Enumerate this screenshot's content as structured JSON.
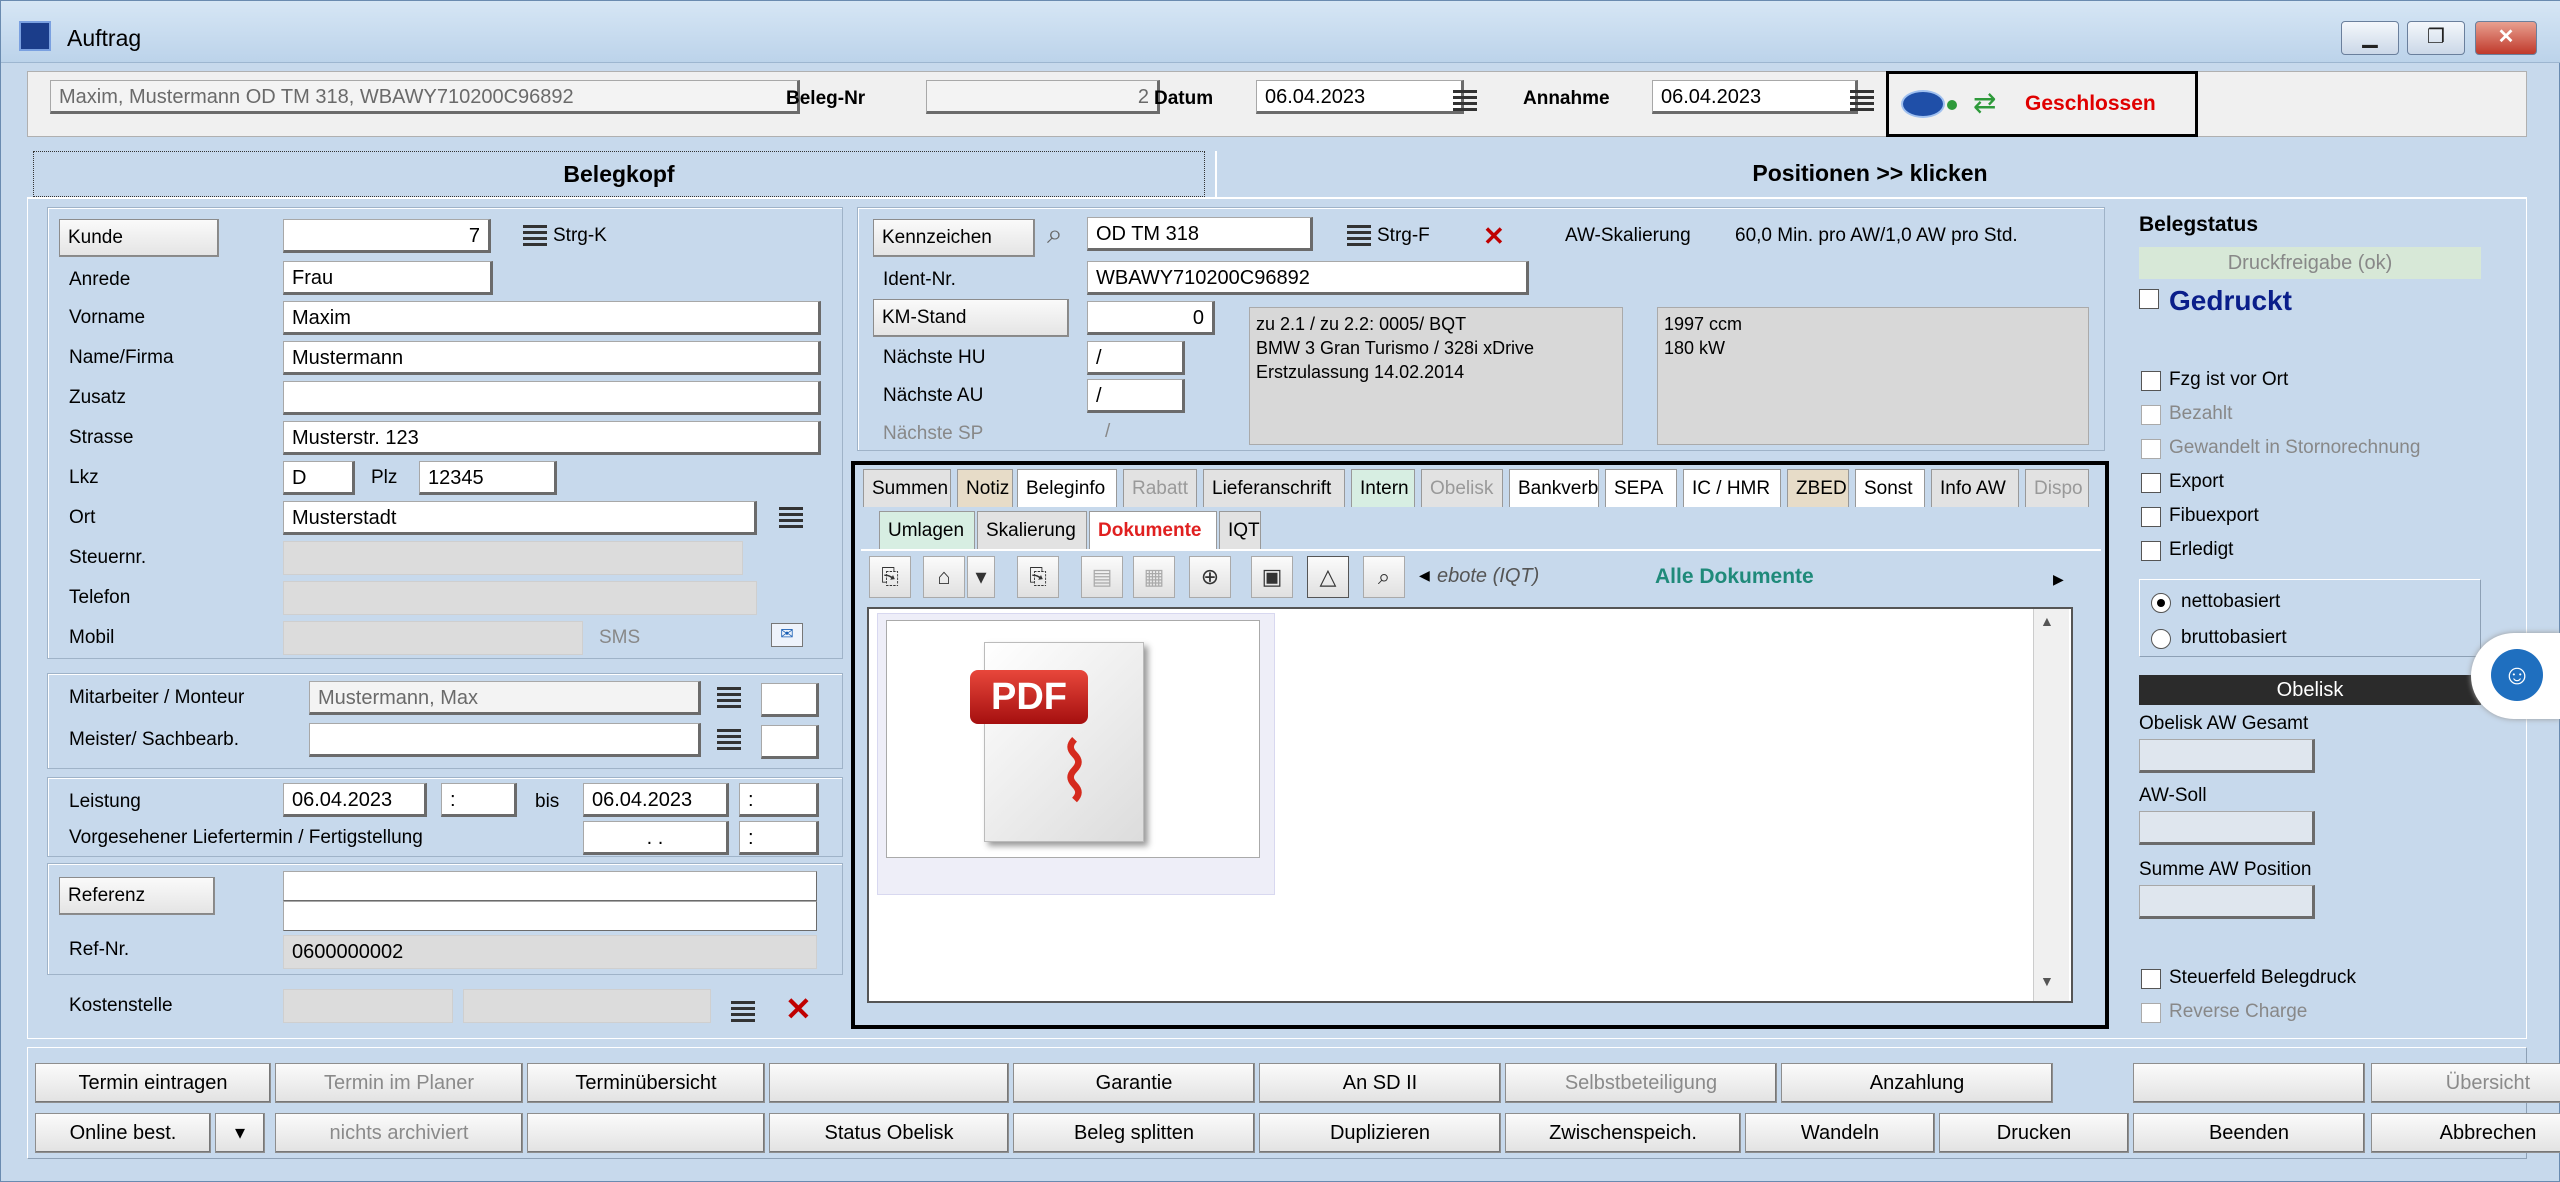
{
  "window": {
    "title": "Auftrag",
    "min": "▁",
    "max": "❐",
    "close": "✕"
  },
  "header": {
    "vehicle_summary": "Maxim, Mustermann OD TM 318, WBAWY710200C96892",
    "beleg_nr_label": "Beleg-Nr",
    "beleg_nr": "2",
    "datum_label": "Datum",
    "datum": "06.04.2023",
    "annahme_label": "Annahme",
    "annahme": "06.04.2023",
    "status": "Geschlossen",
    "status_color": "#e00000"
  },
  "tabs": {
    "belegkopf": "Belegkopf",
    "positionen": "Positionen >> klicken"
  },
  "customer": {
    "kunde_label": "Kunde",
    "kunde": "7",
    "shortcut_k": "Strg-K",
    "anrede_label": "Anrede",
    "anrede": "Frau",
    "vorname_label": "Vorname",
    "vorname": "Maxim",
    "name_label": "Name/Firma",
    "name": "Mustermann",
    "zusatz_label": "Zusatz",
    "zusatz": "",
    "strasse_label": "Strasse",
    "strasse": "Musterstr. 123",
    "lkz_label": "Lkz",
    "lkz": "D",
    "plz_label": "Plz",
    "plz": "12345",
    "ort_label": "Ort",
    "ort": "Musterstadt",
    "steuernr_label": "Steuernr.",
    "telefon_label": "Telefon",
    "mobil_label": "Mobil",
    "sms_label": "SMS"
  },
  "staff": {
    "mitarbeiter_label": "Mitarbeiter / Monteur",
    "mitarbeiter": "Mustermann, Max",
    "meister_label": "Meister/ Sachbearb."
  },
  "service": {
    "leistung_label": "Leistung",
    "leistung_from": "06.04.2023",
    "time_from": ":",
    "bis_label": "bis",
    "leistung_to": "06.04.2023",
    "time_to": ":",
    "liefertermin_label": "Vorgesehener Liefertermin / Fertigstellung",
    "liefer_date": ". .",
    "liefer_time": ":"
  },
  "reference": {
    "referenz_label": "Referenz",
    "refnr_label": "Ref-Nr.",
    "refnr": "0600000002",
    "kostenstelle_label": "Kostenstelle"
  },
  "vehicle": {
    "kennzeichen_label": "Kennzeichen",
    "kennzeichen": "OD TM 318",
    "shortcut_f": "Strg-F",
    "aw_label": "AW-Skalierung",
    "aw_value": "60,0 Min. pro AW/1,0 AW pro Std.",
    "ident_label": "Ident-Nr.",
    "ident": "WBAWY710200C96892",
    "km_label": "KM-Stand",
    "km": "0",
    "hu_label": "Nächste HU",
    "hu": "/",
    "au_label": "Nächste AU",
    "au": "/",
    "sp_label": "Nächste SP",
    "sp": "/",
    "info1": "zu 2.1 / zu 2.2: 0005/ BQT",
    "info2": "BMW 3 Gran Turismo / 328i xDrive",
    "info3": "Erstzulassung 14.02.2014",
    "info4": "1997 ccm",
    "info5": "180 kW"
  },
  "doctabs": {
    "row1": [
      "Summen",
      "Notiz",
      "Beleginfo",
      "Rabatt",
      "Lieferanschrift",
      "Intern",
      "Obelisk",
      "Bankverb",
      "SEPA",
      "IC / HMR",
      "ZBED",
      "Sonst",
      "Info AW",
      "Dispo"
    ],
    "row2": [
      "Umlagen",
      "Skalierung",
      "Dokumente",
      "IQT"
    ],
    "prev_label": "ebote (IQT)",
    "all_docs": "Alle Dokumente",
    "pdf_label": "PDF"
  },
  "status_panel": {
    "title": "Belegstatus",
    "druckfreigabe": "Druckfreigabe (ok)",
    "gedruckt": "Gedruckt",
    "checks": [
      "Fzg ist vor Ort",
      "Bezahlt",
      "Gewandelt in Stornorechnung",
      "Export",
      "Fibuexport",
      "Erledigt"
    ],
    "netto": "nettobasiert",
    "brutto": "bruttobasiert",
    "obelisk_title": "Obelisk",
    "obelisk_aw": "Obelisk AW Gesamt",
    "aw_soll": "AW-Soll",
    "summe_aw": "Summe AW Position",
    "steuerfeld": "Steuerfeld Belegdruck",
    "reverse": "Reverse Charge"
  },
  "buttons": {
    "row1": [
      "Termin eintragen",
      "Termin im Planer",
      "Terminübersicht",
      "",
      "Garantie",
      "An SD II",
      "Selbstbeteiligung",
      "Anzahlung",
      "",
      "Übersicht"
    ],
    "row2": [
      "Online best.",
      "▾",
      "nichts archiviert",
      "",
      "Status Obelisk",
      "Beleg splitten",
      "Duplizieren",
      "Zwischenspeich.",
      "Wandeln",
      "Drucken",
      "Beenden",
      "Abbrechen"
    ]
  }
}
